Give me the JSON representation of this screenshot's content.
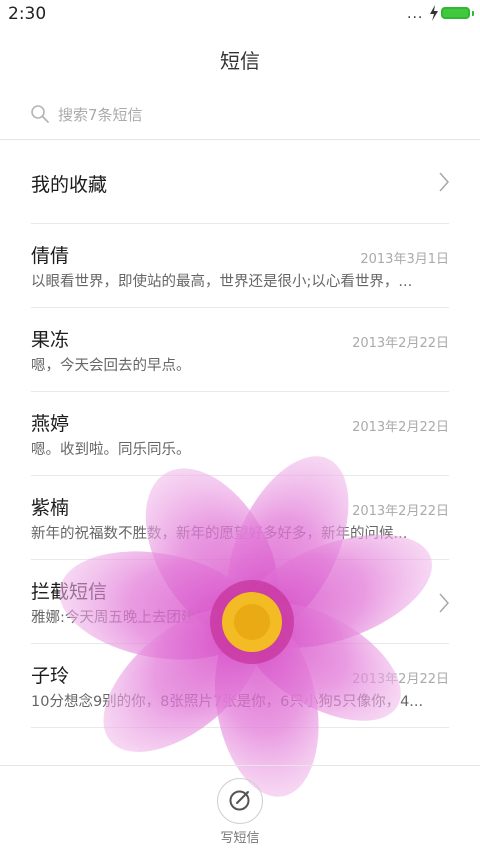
{
  "status": {
    "time": "2:30",
    "dots": "...",
    "battery_color": "#41c83d"
  },
  "app": {
    "title": "短信"
  },
  "search": {
    "placeholder": "搜索7条短信",
    "icon": "search-icon"
  },
  "favorites": {
    "label": "我的收藏"
  },
  "conversations": [
    {
      "name": "倩倩",
      "date": "2013年3月1日",
      "preview": "以眼看世界，即使站的最高，世界还是很小;以心看世界，...",
      "chevron": false
    },
    {
      "name": "果冻",
      "date": "2013年2月22日",
      "preview": "嗯，今天会回去的早点。",
      "chevron": false
    },
    {
      "name": "燕婷",
      "date": "2013年2月22日",
      "preview": "嗯。收到啦。同乐同乐。",
      "chevron": false
    },
    {
      "name": "紫楠",
      "date": "2013年2月22日",
      "preview": "新年的祝福数不胜数，新年的愿望好多好多，新年的问候...",
      "chevron": false
    },
    {
      "name": "拦截短信",
      "date": "",
      "preview": "雅娜:今天周五晚上去团建吧，走起！",
      "chevron": true
    },
    {
      "name": "子玲",
      "date": "2013年2月22日",
      "preview": "10分想念9别的你，8张照片7张是你，6只小狗5只像你，4...",
      "chevron": false
    }
  ],
  "compose": {
    "label": "写短信",
    "icon": "compose-icon"
  },
  "colors": {
    "flower_petal": "#e27ad8",
    "flower_center": "#f4c21c"
  }
}
